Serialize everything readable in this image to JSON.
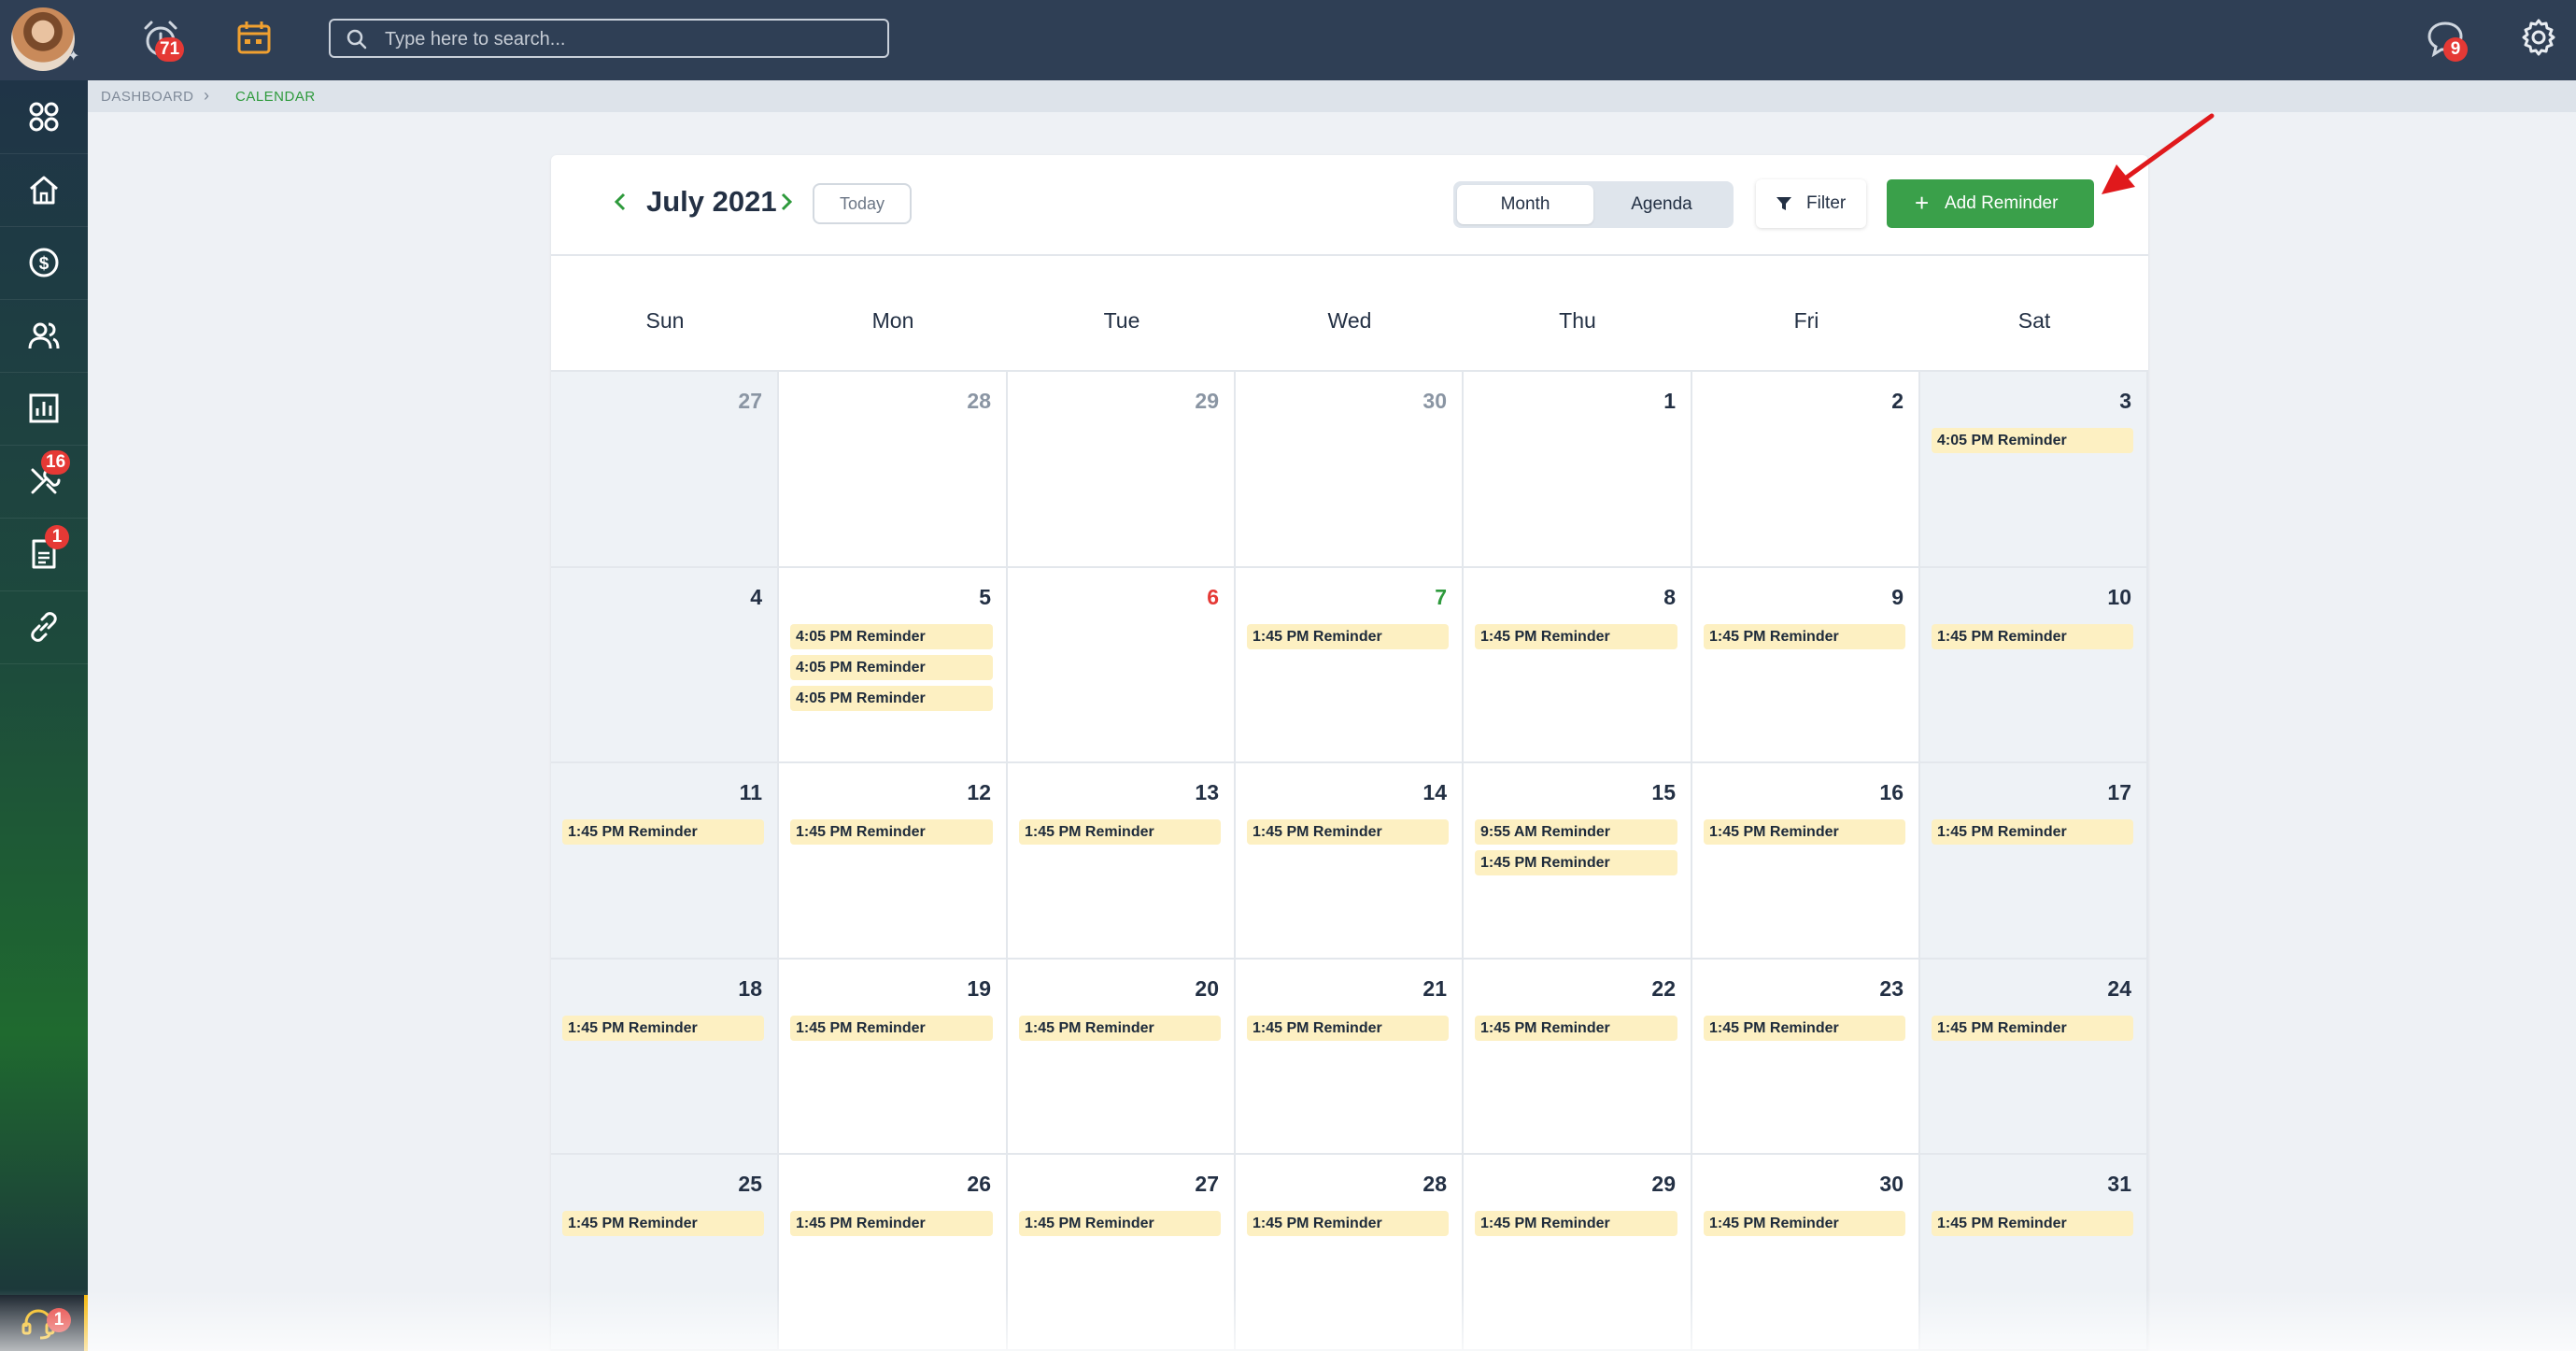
{
  "header": {
    "alarm_badge": "71",
    "chat_badge": "9",
    "search_placeholder": "Type here to search..."
  },
  "sidebar": {
    "tools_badge": "16",
    "docs_badge": "1",
    "support_badge": "1"
  },
  "breadcrumb": {
    "items": [
      "DASHBOARD",
      "CALENDAR"
    ]
  },
  "calendar": {
    "month_title": "July 2021",
    "today_label": "Today",
    "views": [
      "Month",
      "Agenda"
    ],
    "active_view": "Month",
    "filter_label": "Filter",
    "add_label": "Add Reminder",
    "weekdays": [
      "Sun",
      "Mon",
      "Tue",
      "Wed",
      "Thu",
      "Fri",
      "Sat"
    ],
    "weeks": [
      [
        {
          "day": "27",
          "other_month": true,
          "events": []
        },
        {
          "day": "28",
          "other_month": true,
          "events": []
        },
        {
          "day": "29",
          "other_month": true,
          "events": []
        },
        {
          "day": "30",
          "other_month": true,
          "events": []
        },
        {
          "day": "1",
          "events": []
        },
        {
          "day": "2",
          "events": []
        },
        {
          "day": "3",
          "events": [
            "4:05 PM Reminder"
          ]
        }
      ],
      [
        {
          "day": "4",
          "events": []
        },
        {
          "day": "5",
          "events": [
            "4:05 PM Reminder",
            "4:05 PM Reminder",
            "4:05 PM Reminder"
          ]
        },
        {
          "day": "6",
          "highlight": "red",
          "events": []
        },
        {
          "day": "7",
          "highlight": "green",
          "events": [
            "1:45 PM Reminder"
          ]
        },
        {
          "day": "8",
          "events": [
            "1:45 PM Reminder"
          ]
        },
        {
          "day": "9",
          "events": [
            "1:45 PM Reminder"
          ]
        },
        {
          "day": "10",
          "events": [
            "1:45 PM Reminder"
          ]
        }
      ],
      [
        {
          "day": "11",
          "events": [
            "1:45 PM Reminder"
          ]
        },
        {
          "day": "12",
          "events": [
            "1:45 PM Reminder"
          ]
        },
        {
          "day": "13",
          "events": [
            "1:45 PM Reminder"
          ]
        },
        {
          "day": "14",
          "events": [
            "1:45 PM Reminder"
          ]
        },
        {
          "day": "15",
          "events": [
            "9:55 AM Reminder",
            "1:45 PM Reminder"
          ]
        },
        {
          "day": "16",
          "events": [
            "1:45 PM Reminder"
          ]
        },
        {
          "day": "17",
          "events": [
            "1:45 PM Reminder"
          ]
        }
      ],
      [
        {
          "day": "18",
          "events": [
            "1:45 PM Reminder"
          ]
        },
        {
          "day": "19",
          "events": [
            "1:45 PM Reminder"
          ]
        },
        {
          "day": "20",
          "events": [
            "1:45 PM Reminder"
          ]
        },
        {
          "day": "21",
          "events": [
            "1:45 PM Reminder"
          ]
        },
        {
          "day": "22",
          "events": [
            "1:45 PM Reminder"
          ]
        },
        {
          "day": "23",
          "events": [
            "1:45 PM Reminder"
          ]
        },
        {
          "day": "24",
          "events": [
            "1:45 PM Reminder"
          ]
        }
      ],
      [
        {
          "day": "25",
          "events": [
            "1:45 PM Reminder"
          ]
        },
        {
          "day": "26",
          "events": [
            "1:45 PM Reminder"
          ]
        },
        {
          "day": "27",
          "events": [
            "1:45 PM Reminder"
          ]
        },
        {
          "day": "28",
          "events": [
            "1:45 PM Reminder"
          ]
        },
        {
          "day": "29",
          "events": [
            "1:45 PM Reminder"
          ]
        },
        {
          "day": "30",
          "events": [
            "1:45 PM Reminder"
          ]
        },
        {
          "day": "31",
          "events": [
            "1:45 PM Reminder"
          ]
        }
      ]
    ]
  },
  "colors": {
    "topbar": "#2f3f55",
    "accent_green": "#3aa04a",
    "badge_red": "#e53935",
    "event_bg": "#fdf0c2",
    "annotation_arrow": "#e0191c"
  },
  "icons": {
    "topbar": [
      "user-avatar",
      "alarm-clock-icon",
      "calendar-icon",
      "search-icon",
      "chat-icon",
      "gear-icon"
    ],
    "sidebar": [
      "apps-grid-icon",
      "home-icon",
      "dollar-icon",
      "users-icon",
      "chart-icon",
      "tools-icon",
      "document-icon",
      "link-icon",
      "support-headset-icon"
    ]
  }
}
